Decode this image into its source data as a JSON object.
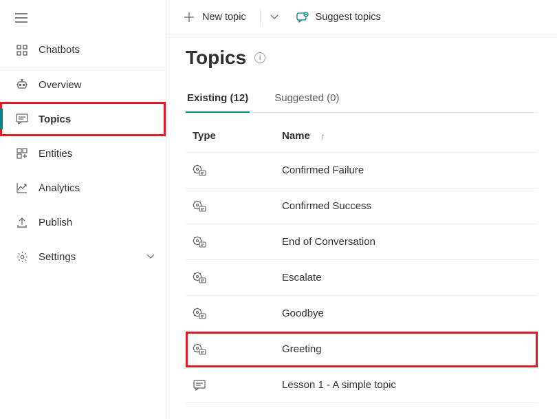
{
  "sidebar": {
    "items": [
      {
        "label": "Chatbots"
      },
      {
        "label": "Overview"
      },
      {
        "label": "Topics"
      },
      {
        "label": "Entities"
      },
      {
        "label": "Analytics"
      },
      {
        "label": "Publish"
      },
      {
        "label": "Settings"
      }
    ]
  },
  "toolbar": {
    "new_topic": "New topic",
    "suggest_topics": "Suggest topics"
  },
  "page": {
    "title": "Topics"
  },
  "tabs": {
    "existing": {
      "label": "Existing",
      "count": 12
    },
    "suggested": {
      "label": "Suggested",
      "count": 0
    }
  },
  "columns": {
    "type": "Type",
    "name": "Name"
  },
  "topics": [
    {
      "kind": "system",
      "name": "Confirmed Failure"
    },
    {
      "kind": "system",
      "name": "Confirmed Success"
    },
    {
      "kind": "system",
      "name": "End of Conversation"
    },
    {
      "kind": "system",
      "name": "Escalate"
    },
    {
      "kind": "system",
      "name": "Goodbye"
    },
    {
      "kind": "system",
      "name": "Greeting"
    },
    {
      "kind": "user",
      "name": "Lesson 1 - A simple topic"
    }
  ],
  "highlight": {
    "nav_index": 2,
    "row_index": 5
  }
}
